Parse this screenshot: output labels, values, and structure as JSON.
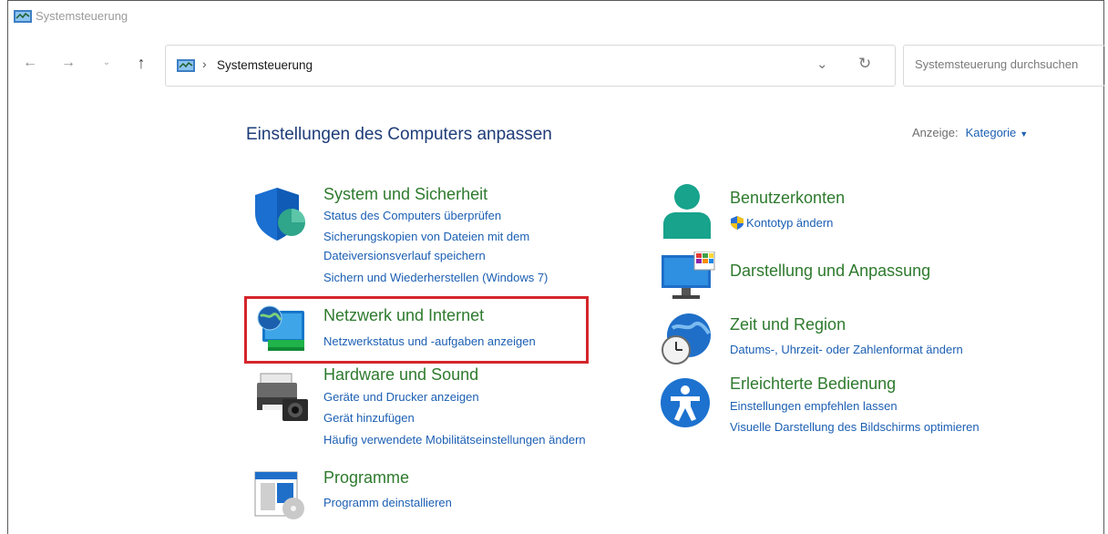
{
  "window": {
    "title": "Systemsteuerung"
  },
  "nav": {
    "back_icon": "back-arrow-icon",
    "forward_icon": "forward-arrow-icon",
    "recent_icon": "chevron-down-icon",
    "up_icon": "up-arrow-icon"
  },
  "address": {
    "crumb": "Systemsteuerung",
    "dropdown_icon": "chevron-down-icon",
    "refresh_icon": "refresh-icon"
  },
  "search": {
    "placeholder": "Systemsteuerung durchsuchen"
  },
  "main": {
    "heading": "Einstellungen des Computers anpassen",
    "view_label": "Anzeige:",
    "view_value": "Kategorie"
  },
  "categories": [
    {
      "title": "System und Sicherheit",
      "icon": "shield-icon",
      "links": [
        "Status des Computers überprüfen",
        "Sicherungskopien von Dateien mit dem",
        "Dateiversionsverlauf speichern",
        "Sichern und Wiederherstellen (Windows 7)"
      ]
    },
    {
      "title": "Netzwerk und Internet",
      "icon": "network-globe-icon",
      "links": [
        "Netzwerkstatus und -aufgaben anzeigen"
      ]
    },
    {
      "title": "Hardware und Sound",
      "icon": "printer-icon",
      "links": [
        "Geräte und Drucker anzeigen",
        "Gerät hinzufügen",
        "Häufig verwendete Mobilitätseinstellungen ändern"
      ]
    },
    {
      "title": "Programme",
      "icon": "programs-icon",
      "links": [
        "Programm deinstallieren"
      ]
    },
    {
      "title": "Benutzerkonten",
      "icon": "user-account-icon",
      "links": [
        "Kontotyp ändern"
      ]
    },
    {
      "title": "Darstellung und Anpassung",
      "icon": "display-icon",
      "links": []
    },
    {
      "title": "Zeit und Region",
      "icon": "clock-globe-icon",
      "links": [
        "Datums-, Uhrzeit- oder Zahlenformat ändern"
      ]
    },
    {
      "title": "Erleichterte Bedienung",
      "icon": "accessibility-icon",
      "links": [
        "Einstellungen empfehlen lassen",
        "Visuelle Darstellung des Bildschirms optimieren"
      ]
    }
  ],
  "colors": {
    "category_title": "#2e7a2e",
    "link": "#1c5fb3",
    "heading": "#1e3c78",
    "highlight": "#d4262b"
  }
}
